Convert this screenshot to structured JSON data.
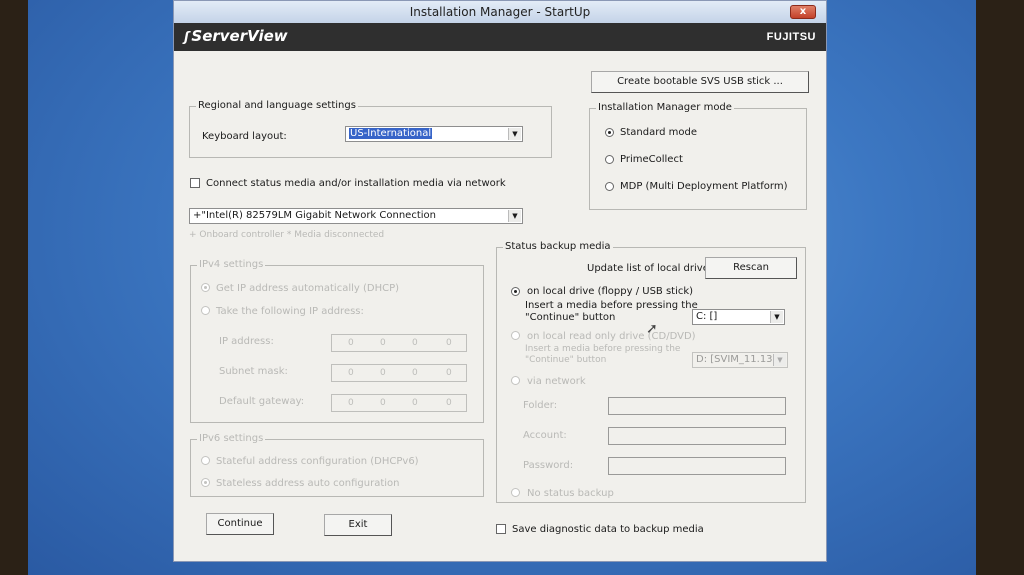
{
  "window": {
    "title": "Installation Manager - StartUp",
    "close_label": "x",
    "brand": "ServerView",
    "vendor": "FUJITSU"
  },
  "usb_button": {
    "label": "Create bootable SVS USB stick ..."
  },
  "regional": {
    "legend": "Regional and language settings",
    "keyboard_label": "Keyboard layout:",
    "keyboard_value": "US-International"
  },
  "mode": {
    "legend": "Installation Manager mode",
    "options": [
      {
        "label": "Standard mode",
        "selected": true
      },
      {
        "label": "PrimeCollect",
        "selected": false
      },
      {
        "label": "MDP (Multi Deployment Platform)",
        "selected": false
      }
    ]
  },
  "network": {
    "connect_label": "Connect status media and/or installation media via network",
    "connect_checked": false,
    "adapter_value": "+\"Intel(R) 82579LM Gigabit Network Connection",
    "adapter_note": "+ Onboard controller   * Media disconnected"
  },
  "ipv4": {
    "legend": "IPv4 settings",
    "dhcp_label": "Get IP address automatically (DHCP)",
    "static_label": "Take the following IP address:",
    "fields": [
      {
        "label": "IP address:",
        "value": "0 . 0 . 0 . 0",
        "octets": [
          "0",
          "0",
          "0",
          "0"
        ]
      },
      {
        "label": "Subnet mask:",
        "value": "0 . 0 . 0 . 0",
        "octets": [
          "0",
          "0",
          "0",
          "0"
        ]
      },
      {
        "label": "Default gateway:",
        "value": "0 . 0 . 0 . 0",
        "octets": [
          "0",
          "0",
          "0",
          "0"
        ]
      }
    ]
  },
  "ipv6": {
    "legend": "IPv6 settings",
    "stateful_label": "Stateful address configuration (DHCPv6)",
    "stateless_label": "Stateless address auto configuration"
  },
  "backup": {
    "legend": "Status backup media",
    "update_label": "Update list of local drives",
    "rescan_label": "Rescan",
    "local_drive_label": "on local drive (floppy / USB stick)",
    "local_drive_hint_1": "Insert a media before pressing the",
    "local_drive_hint_2": "\"Continue\" button",
    "local_drive_value": "C: []",
    "readonly_label": "on local read only drive (CD/DVD)",
    "readonly_hint_1": "Insert a media before pressing the",
    "readonly_hint_2": "\"Continue\" button",
    "readonly_value": "D: [SVIM_11.13.",
    "via_network_label": "via network",
    "folder_label": "Folder:",
    "account_label": "Account:",
    "password_label": "Password:",
    "no_backup_label": "No status backup"
  },
  "footer": {
    "continue_label": "Continue",
    "exit_label": "Exit",
    "diag_label": "Save diagnostic data to backup media",
    "diag_checked": false
  }
}
